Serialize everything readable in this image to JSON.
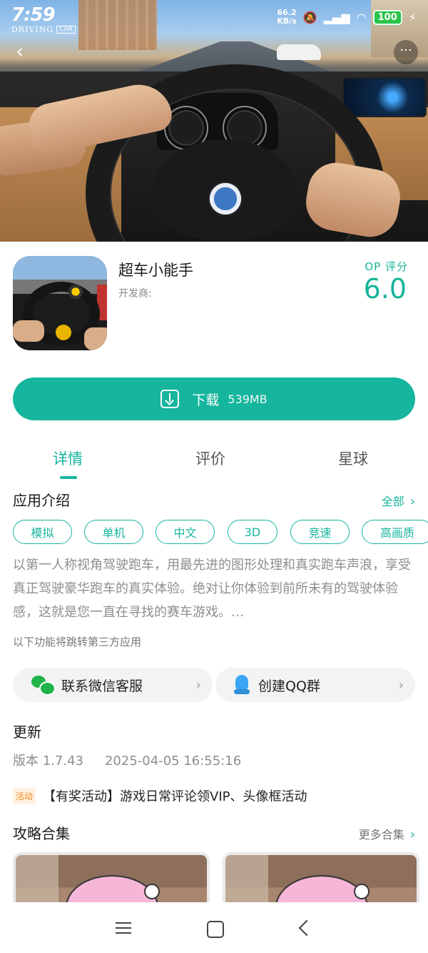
{
  "status_bar": {
    "time": "7:59",
    "brand_word": "DRIVING",
    "brand_car": "CAR",
    "net_speed": "66.2",
    "net_unit": "KB/s",
    "battery": "100"
  },
  "app": {
    "name": "超车小能手",
    "developer": "开发商:",
    "rating_label": "OP 评分",
    "rating_value": "6.0"
  },
  "download": {
    "label": "下载",
    "size": "539MB"
  },
  "tabs": [
    {
      "label": "详情",
      "active": true
    },
    {
      "label": "评价",
      "active": false
    },
    {
      "label": "星球",
      "active": false
    }
  ],
  "intro": {
    "title": "应用介绍",
    "all_label": "全部",
    "tags": [
      "模拟",
      "单机",
      "中文",
      "3D",
      "竞速",
      "高画质"
    ],
    "description": "以第一人称视角驾驶跑车，用最先进的图形处理和真实跑车声浪，享受真正驾驶豪华跑车的真实体验。绝对让你体验到前所未有的驾驶体验感，这就是您一直在寻找的赛车游戏。…",
    "third_party_note": "以下功能将跳转第三方应用"
  },
  "services": {
    "wechat_label": "联系微信客服",
    "qq_label": "创建QQ群"
  },
  "update": {
    "title": "更新",
    "version": "版本 1.7.43",
    "date": "2025-04-05 16:55:16"
  },
  "activity": {
    "badge": "活动",
    "text": "【有奖活动】游戏日常评论领VIP、头像框活动"
  },
  "guides": {
    "title": "攻略合集",
    "more_label": "更多合集"
  },
  "colors": {
    "accent": "#16b59d",
    "wechat": "#1fb44a",
    "qq": "#3aa6f3",
    "activity": "#f08a1f"
  }
}
